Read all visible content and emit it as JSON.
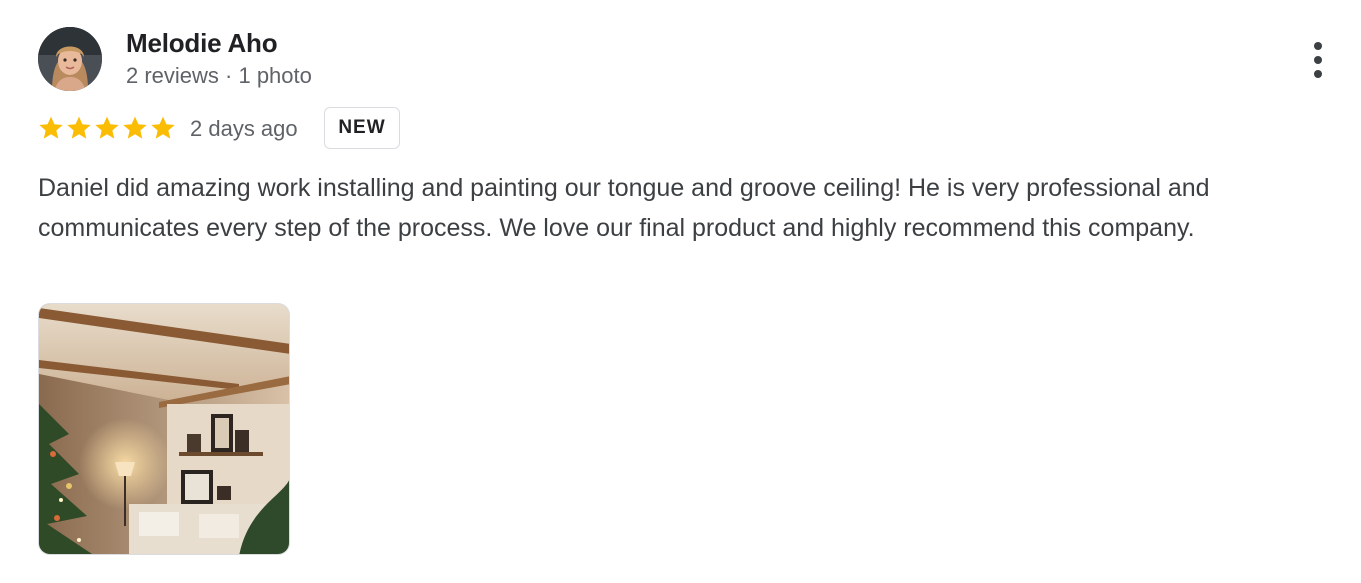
{
  "review": {
    "author_name": "Melodie Aho",
    "author_meta": "2 reviews · 1 photo",
    "rating": 5,
    "rating_max": 5,
    "date": "2 days ago",
    "badge": "NEW",
    "text": "Daniel did amazing work installing and painting our tongue and groove ceiling! He is very professional and communicates every step of the process. We love our final product and highly recommend this company.",
    "more_icon": "more-vertical-icon",
    "star_icon": "star-icon",
    "photo_icon": "review-photo"
  },
  "colors": {
    "star": "#fbbc04",
    "text": "#3c4043",
    "muted": "#5f6368"
  }
}
